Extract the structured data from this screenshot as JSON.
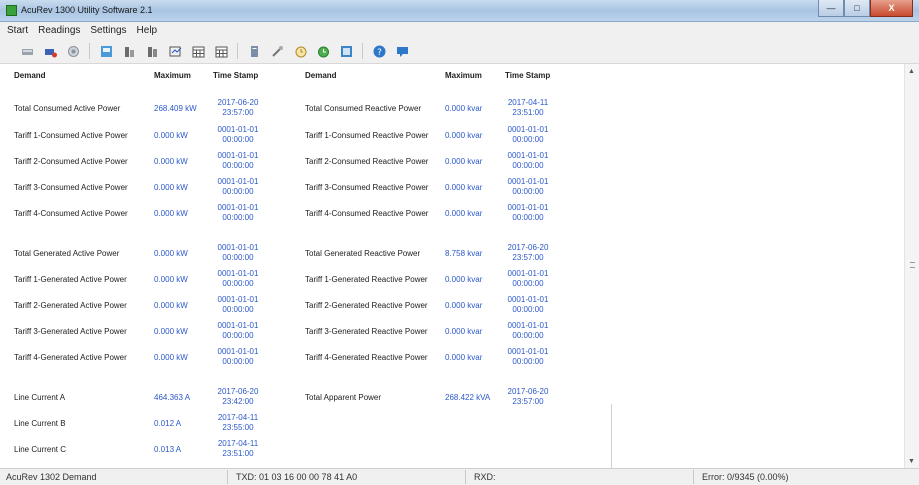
{
  "window": {
    "title": "AcuRev 1300 Utility Software 2.1",
    "minimize": "—",
    "maximize": "□",
    "close": "X"
  },
  "menu": [
    "Start",
    "Readings",
    "Settings",
    "Help"
  ],
  "toolbar_icons": [
    "connect-icon",
    "disconnect-icon",
    "search-device-icon",
    "device-icon",
    "realtime-icon",
    "energy-icon",
    "demand-icon",
    "calendar-icon",
    "calendar-alt-icon",
    "report-icon",
    "tools-icon",
    "timer-icon",
    "alarm-icon",
    "log-icon",
    "help-icon",
    "about-icon"
  ],
  "headers": {
    "demand": "Demand",
    "maximum": "Maximum",
    "timestamp": "Time Stamp"
  },
  "left_rows": [
    {
      "label": "Total Consumed Active Power",
      "value": "268.409 kW",
      "ts1": "2017-06-20",
      "ts2": "23:57:00"
    },
    {
      "label": "Tariff 1-Consumed Active Power",
      "value": "0.000 kW",
      "ts1": "0001-01-01",
      "ts2": "00:00:00"
    },
    {
      "label": "Tariff 2-Consumed Active Power",
      "value": "0.000 kW",
      "ts1": "0001-01-01",
      "ts2": "00:00:00"
    },
    {
      "label": "Tariff 3-Consumed Active Power",
      "value": "0.000 kW",
      "ts1": "0001-01-01",
      "ts2": "00:00:00"
    },
    {
      "label": "Tariff 4-Consumed Active Power",
      "value": "0.000 kW",
      "ts1": "0001-01-01",
      "ts2": "00:00:00"
    },
    {
      "label": "Total Generated Active Power",
      "value": "0.000 kW",
      "ts1": "0001-01-01",
      "ts2": "00:00:00"
    },
    {
      "label": "Tariff 1-Generated Active Power",
      "value": "0.000 kW",
      "ts1": "0001-01-01",
      "ts2": "00:00:00"
    },
    {
      "label": "Tariff 2-Generated Active Power",
      "value": "0.000 kW",
      "ts1": "0001-01-01",
      "ts2": "00:00:00"
    },
    {
      "label": "Tariff 3-Generated Active Power",
      "value": "0.000 kW",
      "ts1": "0001-01-01",
      "ts2": "00:00:00"
    },
    {
      "label": "Tariff 4-Generated Active Power",
      "value": "0.000 kW",
      "ts1": "0001-01-01",
      "ts2": "00:00:00"
    },
    {
      "label": "Line Current A",
      "value": "464.363 A",
      "ts1": "2017-06-20",
      "ts2": "23:42:00"
    },
    {
      "label": "Line Current B",
      "value": "0.012 A",
      "ts1": "2017-04-11",
      "ts2": "23:55:00"
    },
    {
      "label": "Line Current C",
      "value": "0.013 A",
      "ts1": "2017-04-11",
      "ts2": "23:51:00"
    }
  ],
  "right_rows": [
    {
      "label": "Total Consumed Reactive Power",
      "value": "0.000 kvar",
      "ts1": "2017-04-11",
      "ts2": "23:51:00"
    },
    {
      "label": "Tariff 1-Consumed Reactive Power",
      "value": "0.000 kvar",
      "ts1": "0001-01-01",
      "ts2": "00:00:00"
    },
    {
      "label": "Tariff 2-Consumed Reactive Power",
      "value": "0.000 kvar",
      "ts1": "0001-01-01",
      "ts2": "00:00:00"
    },
    {
      "label": "Tariff 3-Consumed Reactive Power",
      "value": "0.000 kvar",
      "ts1": "0001-01-01",
      "ts2": "00:00:00"
    },
    {
      "label": "Tariff 4-Consumed Reactive Power",
      "value": "0.000 kvar",
      "ts1": "0001-01-01",
      "ts2": "00:00:00"
    },
    {
      "label": "Total Generated Reactive Power",
      "value": "8.758 kvar",
      "ts1": "2017-06-20",
      "ts2": "23:57:00"
    },
    {
      "label": "Tariff 1-Generated Reactive Power",
      "value": "0.000 kvar",
      "ts1": "0001-01-01",
      "ts2": "00:00:00"
    },
    {
      "label": "Tariff 2-Generated Reactive Power",
      "value": "0.000 kvar",
      "ts1": "0001-01-01",
      "ts2": "00:00:00"
    },
    {
      "label": "Tariff 3-Generated Reactive Power",
      "value": "0.000 kvar",
      "ts1": "0001-01-01",
      "ts2": "00:00:00"
    },
    {
      "label": "Tariff 4-Generated Reactive Power",
      "value": "0.000 kvar",
      "ts1": "0001-01-01",
      "ts2": "00:00:00"
    },
    {
      "label": "Total Apparent Power",
      "value": "268.422 kVA",
      "ts1": "2017-06-20",
      "ts2": "23:57:00"
    }
  ],
  "status": {
    "device": "AcuRev 1302 Demand",
    "txd": "TXD: 01 03 16 00 00 78 41 A0",
    "rxd": "RXD:",
    "error": "Error: 0/9345 (0.00%)"
  },
  "colors": {
    "value_blue": "#2b58c9",
    "title_bar": "#b9cfe8"
  }
}
